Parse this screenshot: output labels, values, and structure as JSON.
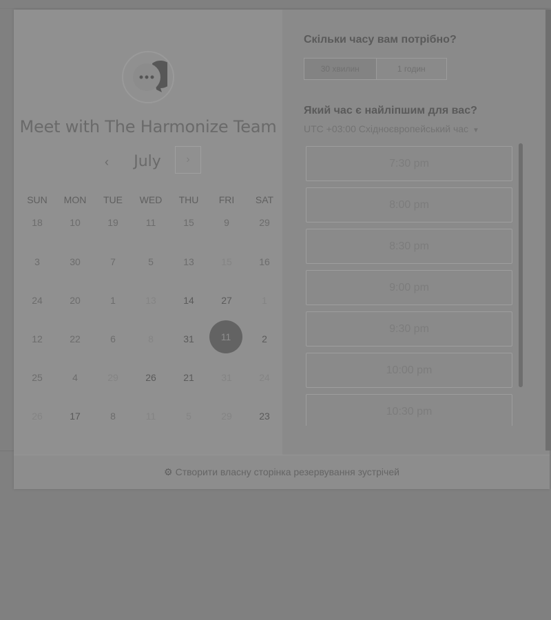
{
  "meeting": {
    "title": "Meet with The Harmonize Team"
  },
  "calendar": {
    "month": "July",
    "prev_icon": "‹",
    "next_icon": "›",
    "weekdays": [
      "SUN",
      "MON",
      "TUE",
      "WED",
      "THU",
      "FRI",
      "SAT"
    ],
    "weeks": [
      [
        "18",
        "10",
        "19",
        "11",
        "15",
        "9",
        "29"
      ],
      [
        "3",
        "30",
        "7",
        "5",
        "13",
        "15",
        "16"
      ],
      [
        "24",
        "20",
        "1",
        "13",
        "14",
        "27",
        "1"
      ],
      [
        "12",
        "22",
        "6",
        "8",
        "31",
        "11",
        "2"
      ],
      [
        "25",
        "4",
        "29",
        "26",
        "21",
        "31",
        "24"
      ],
      [
        "26",
        "17",
        "8",
        "11",
        "5",
        "29",
        "23"
      ]
    ],
    "selected": "11"
  },
  "duration": {
    "question": "Скільки часу вам потрібно?",
    "options": [
      "30 хвилин",
      "1 годин"
    ],
    "selected": "30 хвилин"
  },
  "time": {
    "question": "Який час є найліпшим для вас?",
    "timezone": "UTC +03:00 Східноєвропейський час",
    "slots": [
      "7:30 pm",
      "8:00 pm",
      "8:30 pm",
      "9:00 pm",
      "9:30 pm",
      "10:00 pm",
      "10:30 pm"
    ]
  },
  "footer": {
    "text": "Створити власну сторінка резервування зустрічей"
  },
  "colors": {
    "overlay": "#808080",
    "selected_day": "#636363"
  },
  "icons": {
    "avatar": "chat-bubble-icon",
    "footer": "sprocket-icon",
    "timezone": "caret-down-icon"
  }
}
